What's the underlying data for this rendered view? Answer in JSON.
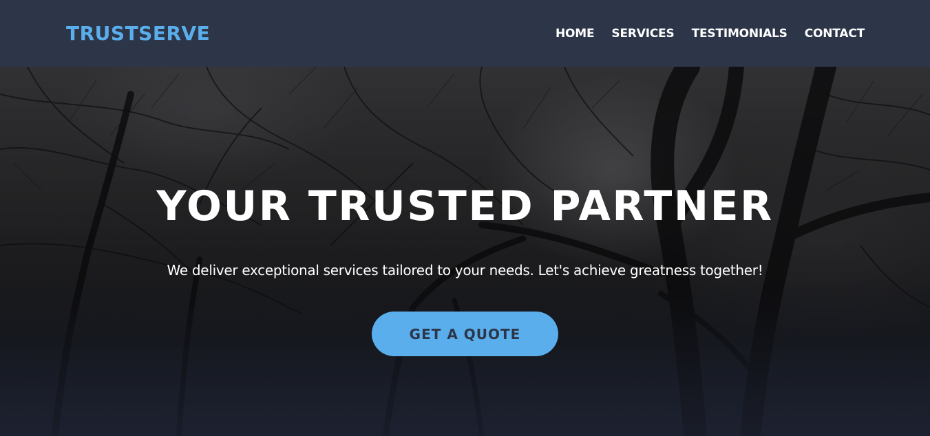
{
  "brand": {
    "logo_text": "TRUSTSERVE",
    "accent_color": "#5aaeec",
    "nav_bg": "#2d3549"
  },
  "nav": {
    "items": [
      {
        "label": "HOME"
      },
      {
        "label": "SERVICES"
      },
      {
        "label": "TESTIMONIALS"
      },
      {
        "label": "CONTACT"
      }
    ]
  },
  "hero": {
    "title": "YOUR TRUSTED PARTNER",
    "subtitle": "We deliver exceptional services tailored to your needs. Let's achieve greatness together!",
    "cta_label": "GET A QUOTE",
    "background": "dark forest photo"
  }
}
